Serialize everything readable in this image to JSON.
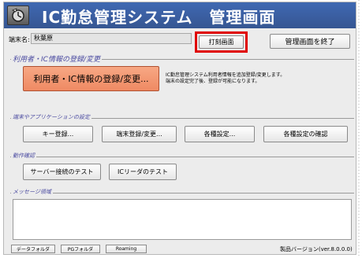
{
  "window": {
    "title": "IC勤怠管理システム　管理画面"
  },
  "terminal": {
    "label": "端末名:",
    "value": "秋葉原"
  },
  "toolbar": {
    "print_label": "打刻画面",
    "exit_label": "管理画面を終了"
  },
  "user_group": {
    "title": "利用者・IC情報の登録/変更",
    "register_label": "利用者・IC情報の登録/変更...",
    "description_line1": "IC勤怠管理システム利用者情報を追加登録/変更します。",
    "description_line2": "端末の設定完了後、登録が可能になります。"
  },
  "settings_group": {
    "title": "端末やアプリケーションの設定",
    "buttons": [
      "キー登録...",
      "端末登録/変更...",
      "各種設定...",
      "各種設定の確認"
    ]
  },
  "check_group": {
    "title": "動作確認",
    "buttons": [
      "サーバー接続のテスト",
      "ICリーダのテスト"
    ]
  },
  "message_group": {
    "title": "メッセージ領域",
    "content": ""
  },
  "footer": {
    "buttons": [
      "データフォルダ",
      "PGフォルダ",
      "Roaming"
    ],
    "version": "製品バージョン(ver.8.0.0.0)"
  },
  "colors": {
    "title_bar": "#3a5d9f",
    "register_button": "#f29470",
    "highlight_frame": "#e00000",
    "group_title": "#4a4aa0"
  }
}
